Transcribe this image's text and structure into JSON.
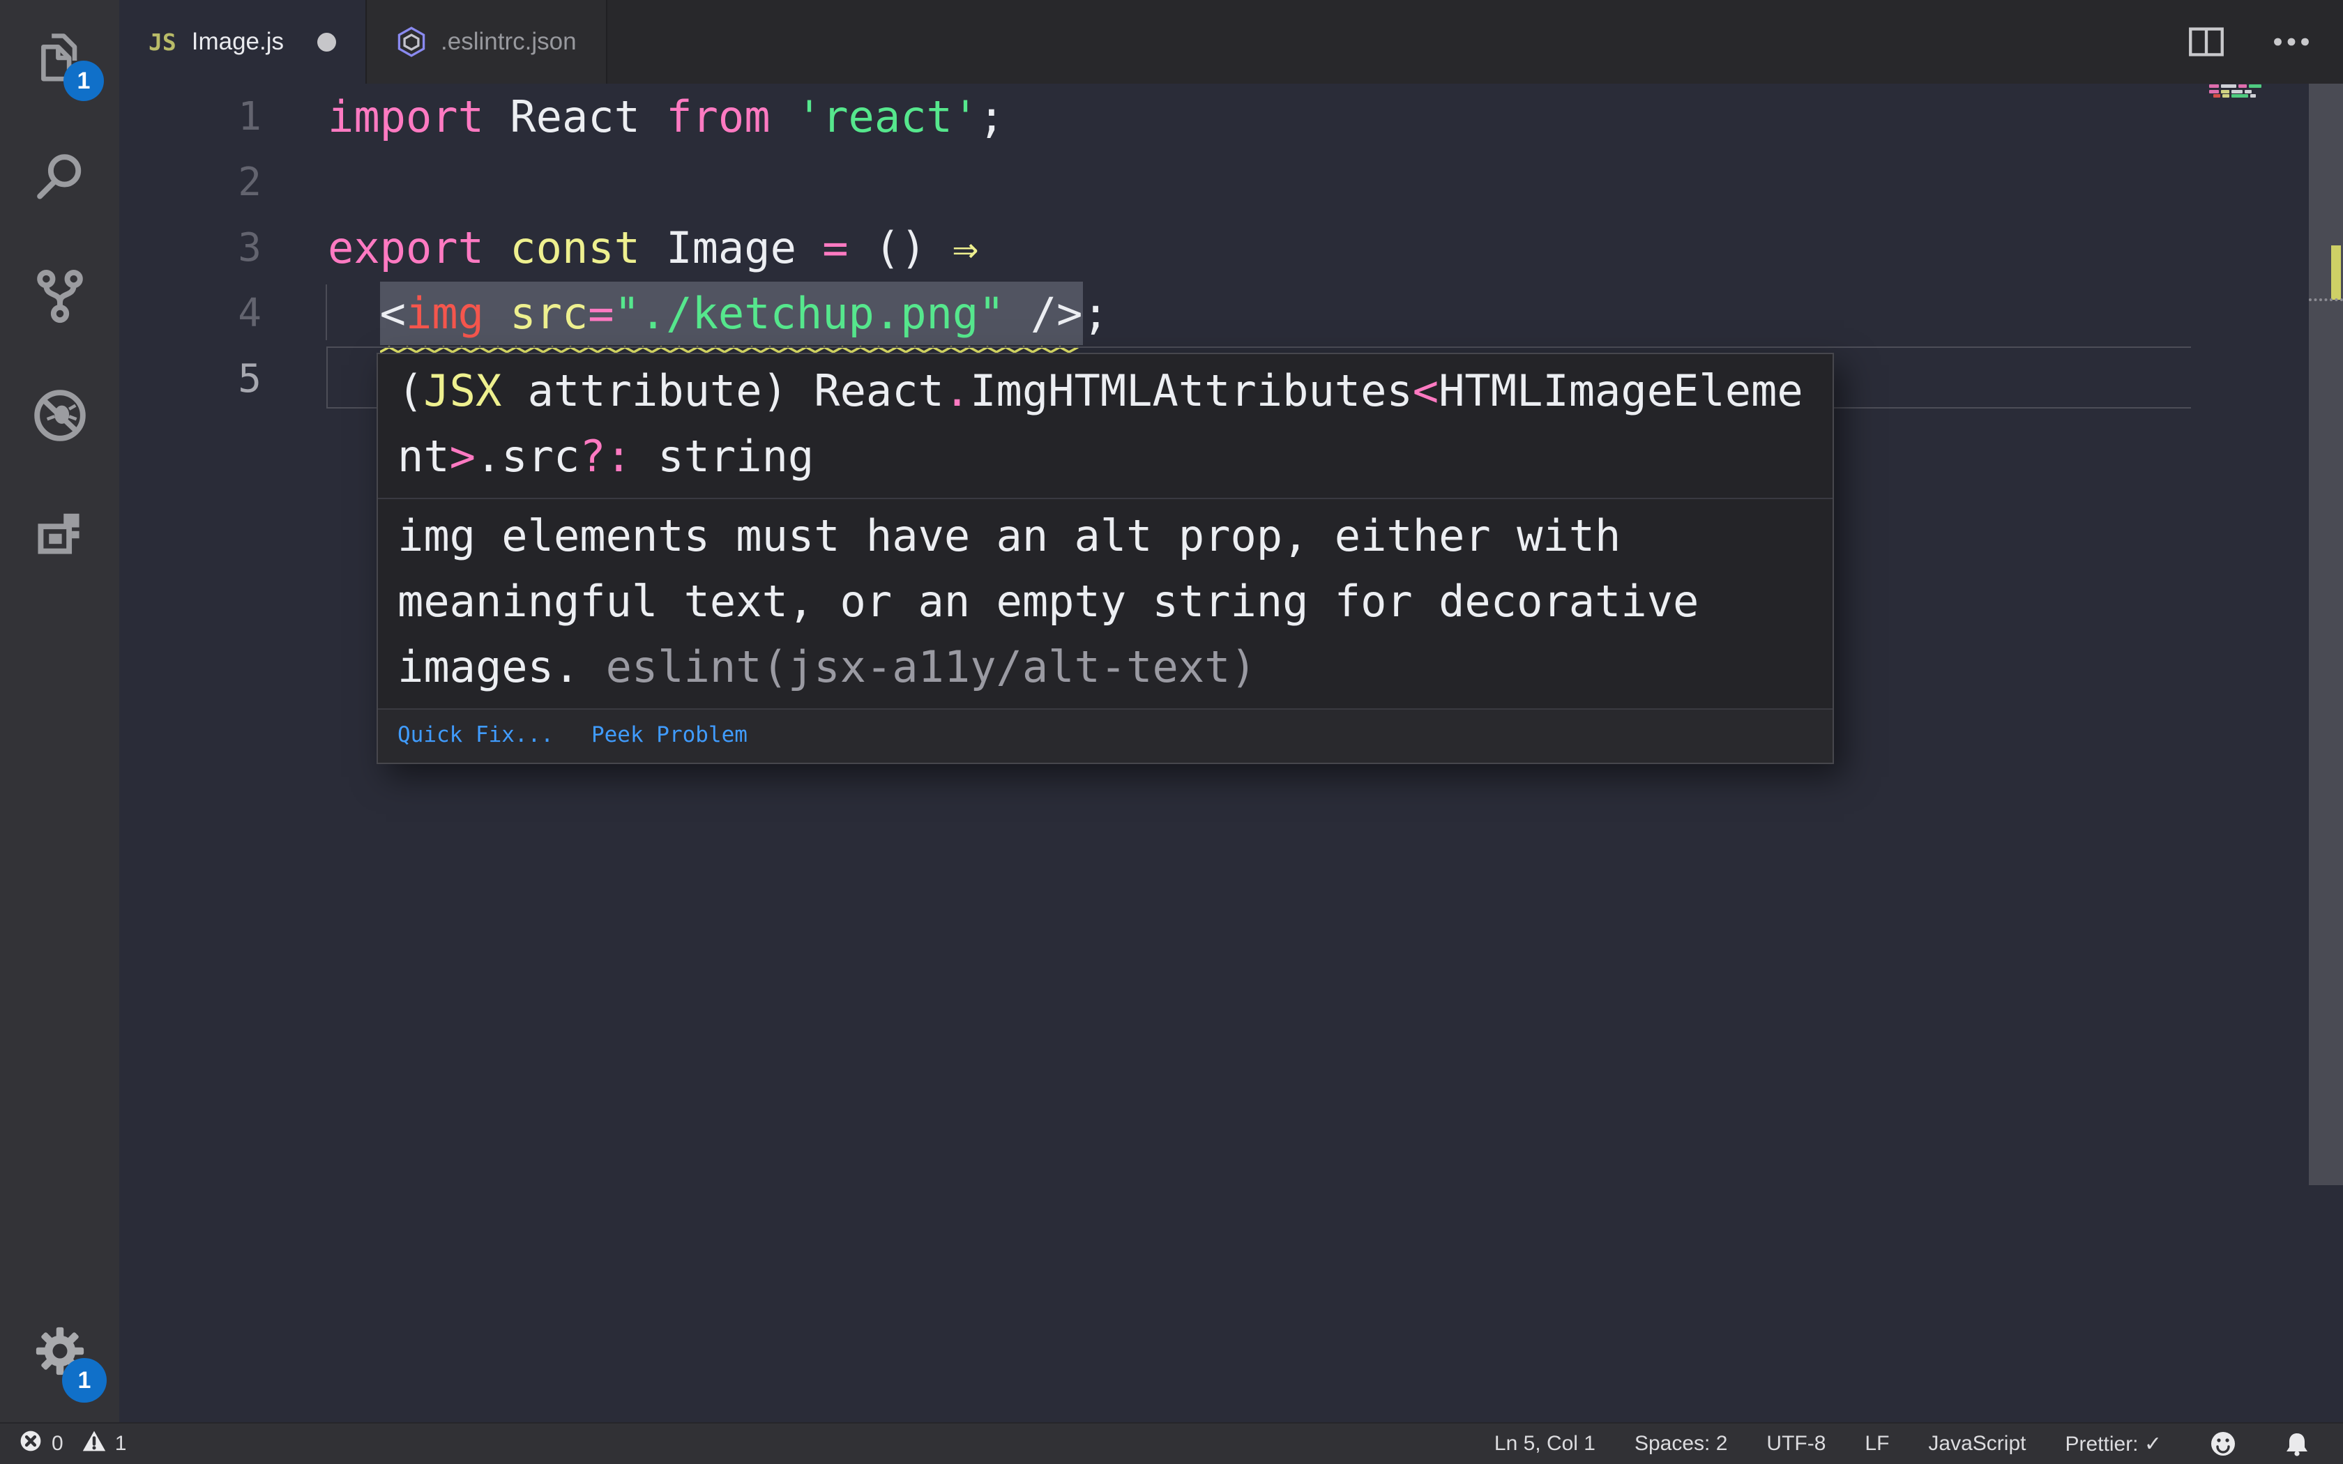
{
  "colors": {
    "editor_bg": "#2a2c38",
    "tabbar_bg": "#28282b",
    "tab_inactive_bg": "#2c2c2f",
    "tab_active_bg": "#2a2c38",
    "activitybar_bg": "#333337",
    "statusbar_bg": "#313135",
    "pink": "#ff7ac2",
    "yellow": "#eef08f",
    "green": "#56e78d",
    "red": "#f5564d",
    "white": "#eceef2",
    "gray": "#9a9aa2",
    "linenum": "#63646f",
    "linenum_active": "#a7a8b0",
    "hl_bg": "#515461",
    "squiggle": "#e5e76a",
    "badge": "#1070c9",
    "link": "#409cff",
    "hover_bg": "#242428",
    "hover_border": "#47474d",
    "slider": "#4a4b54",
    "current_line_border": "#4d4e58",
    "icon_gray": "#9b9ca0"
  },
  "activity_bar": {
    "items": [
      {
        "name": "explorer",
        "badge": "1"
      },
      {
        "name": "search"
      },
      {
        "name": "source-control"
      },
      {
        "name": "debug"
      },
      {
        "name": "extensions"
      }
    ],
    "settings": {
      "name": "settings",
      "badge": "1"
    }
  },
  "tab_bar": {
    "tabs": [
      {
        "label": "Image.js",
        "icon_text": "JS",
        "modified": true,
        "active": true
      },
      {
        "label": ".eslintrc.json",
        "icon": "eslint",
        "modified": false,
        "active": false
      }
    ],
    "actions": [
      "split-editor",
      "more-actions"
    ]
  },
  "editor": {
    "lines": [
      {
        "num": "1",
        "segments": [
          {
            "t": "import",
            "c": "pink"
          },
          {
            "t": " React ",
            "c": "white"
          },
          {
            "t": "from",
            "c": "pink"
          },
          {
            "t": " ",
            "c": "white"
          },
          {
            "t": "'react'",
            "c": "green"
          },
          {
            "t": ";",
            "c": "white"
          }
        ]
      },
      {
        "num": "2",
        "segments": []
      },
      {
        "num": "3",
        "segments": [
          {
            "t": "export",
            "c": "pink"
          },
          {
            "t": " ",
            "c": "white"
          },
          {
            "t": "const",
            "c": "yellow"
          },
          {
            "t": " Image ",
            "c": "white"
          },
          {
            "t": "=",
            "c": "pink"
          },
          {
            "t": " () ",
            "c": "white"
          },
          {
            "t": "⇒",
            "c": "yellow"
          }
        ]
      },
      {
        "num": "4",
        "guide": true,
        "segments": [
          {
            "t": "  ",
            "c": "white"
          },
          {
            "t": "<",
            "c": "white",
            "hl": true
          },
          {
            "t": "img",
            "c": "red",
            "hl": true
          },
          {
            "t": " ",
            "c": "white",
            "hl": true
          },
          {
            "t": "src",
            "c": "yellow",
            "hl": true
          },
          {
            "t": "=",
            "c": "pink",
            "hl": true
          },
          {
            "t": "\"./ketchup.png\"",
            "c": "green",
            "hl": true
          },
          {
            "t": " ",
            "c": "white",
            "hl": true
          },
          {
            "t": "/>",
            "c": "white",
            "hl": true
          },
          {
            "t": ";",
            "c": "white"
          }
        ]
      },
      {
        "num": "5",
        "current": true,
        "segments": []
      }
    ],
    "minimap_rows": [
      {
        "x": 28,
        "y": 1,
        "segs": [
          {
            "w": 14,
            "c": "pink"
          },
          {
            "w": 22,
            "c": "white"
          },
          {
            "w": 12,
            "c": "pink"
          },
          {
            "w": 18,
            "c": "green"
          }
        ]
      },
      {
        "x": 28,
        "y": 9,
        "segs": [
          {
            "w": 14,
            "c": "pink"
          },
          {
            "w": 12,
            "c": "yellow"
          },
          {
            "w": 16,
            "c": "white"
          },
          {
            "w": 10,
            "c": "white"
          }
        ]
      },
      {
        "x": 34,
        "y": 15,
        "segs": [
          {
            "w": 10,
            "c": "red"
          },
          {
            "w": 10,
            "c": "yellow"
          },
          {
            "w": 24,
            "c": "green"
          },
          {
            "w": 8,
            "c": "white"
          }
        ]
      }
    ]
  },
  "hover": {
    "signature_tokens": [
      {
        "t": "(",
        "c": "white"
      },
      {
        "t": "JSX",
        "c": "yellow"
      },
      {
        "t": " attribute) React",
        "c": "white"
      },
      {
        "t": ".",
        "c": "pink"
      },
      {
        "t": "ImgHTMLAttributes",
        "c": "white"
      },
      {
        "t": "<",
        "c": "pink"
      },
      {
        "t": "HTMLImageElement",
        "c": "white"
      },
      {
        "t": ">",
        "c": "pink"
      },
      {
        "t": ".src",
        "c": "white"
      },
      {
        "t": "?:",
        "c": "pink"
      },
      {
        "t": " string",
        "c": "white"
      }
    ],
    "message": "img elements must have an alt prop, either with meaningful text, or an empty string for decorative images. ",
    "rule": "eslint(jsx-a11y/alt-text)",
    "actions": [
      {
        "label": "Quick Fix..."
      },
      {
        "label": "Peek Problem"
      }
    ]
  },
  "status_bar": {
    "problems": {
      "errors": "0",
      "warnings": "1"
    },
    "right": [
      {
        "name": "line-col",
        "label": "Ln 5, Col 1"
      },
      {
        "name": "indentation",
        "label": "Spaces: 2"
      },
      {
        "name": "encoding",
        "label": "UTF-8"
      },
      {
        "name": "eol",
        "label": "LF"
      },
      {
        "name": "language",
        "label": "JavaScript"
      },
      {
        "name": "formatter",
        "label": "Prettier: ✓"
      }
    ]
  }
}
